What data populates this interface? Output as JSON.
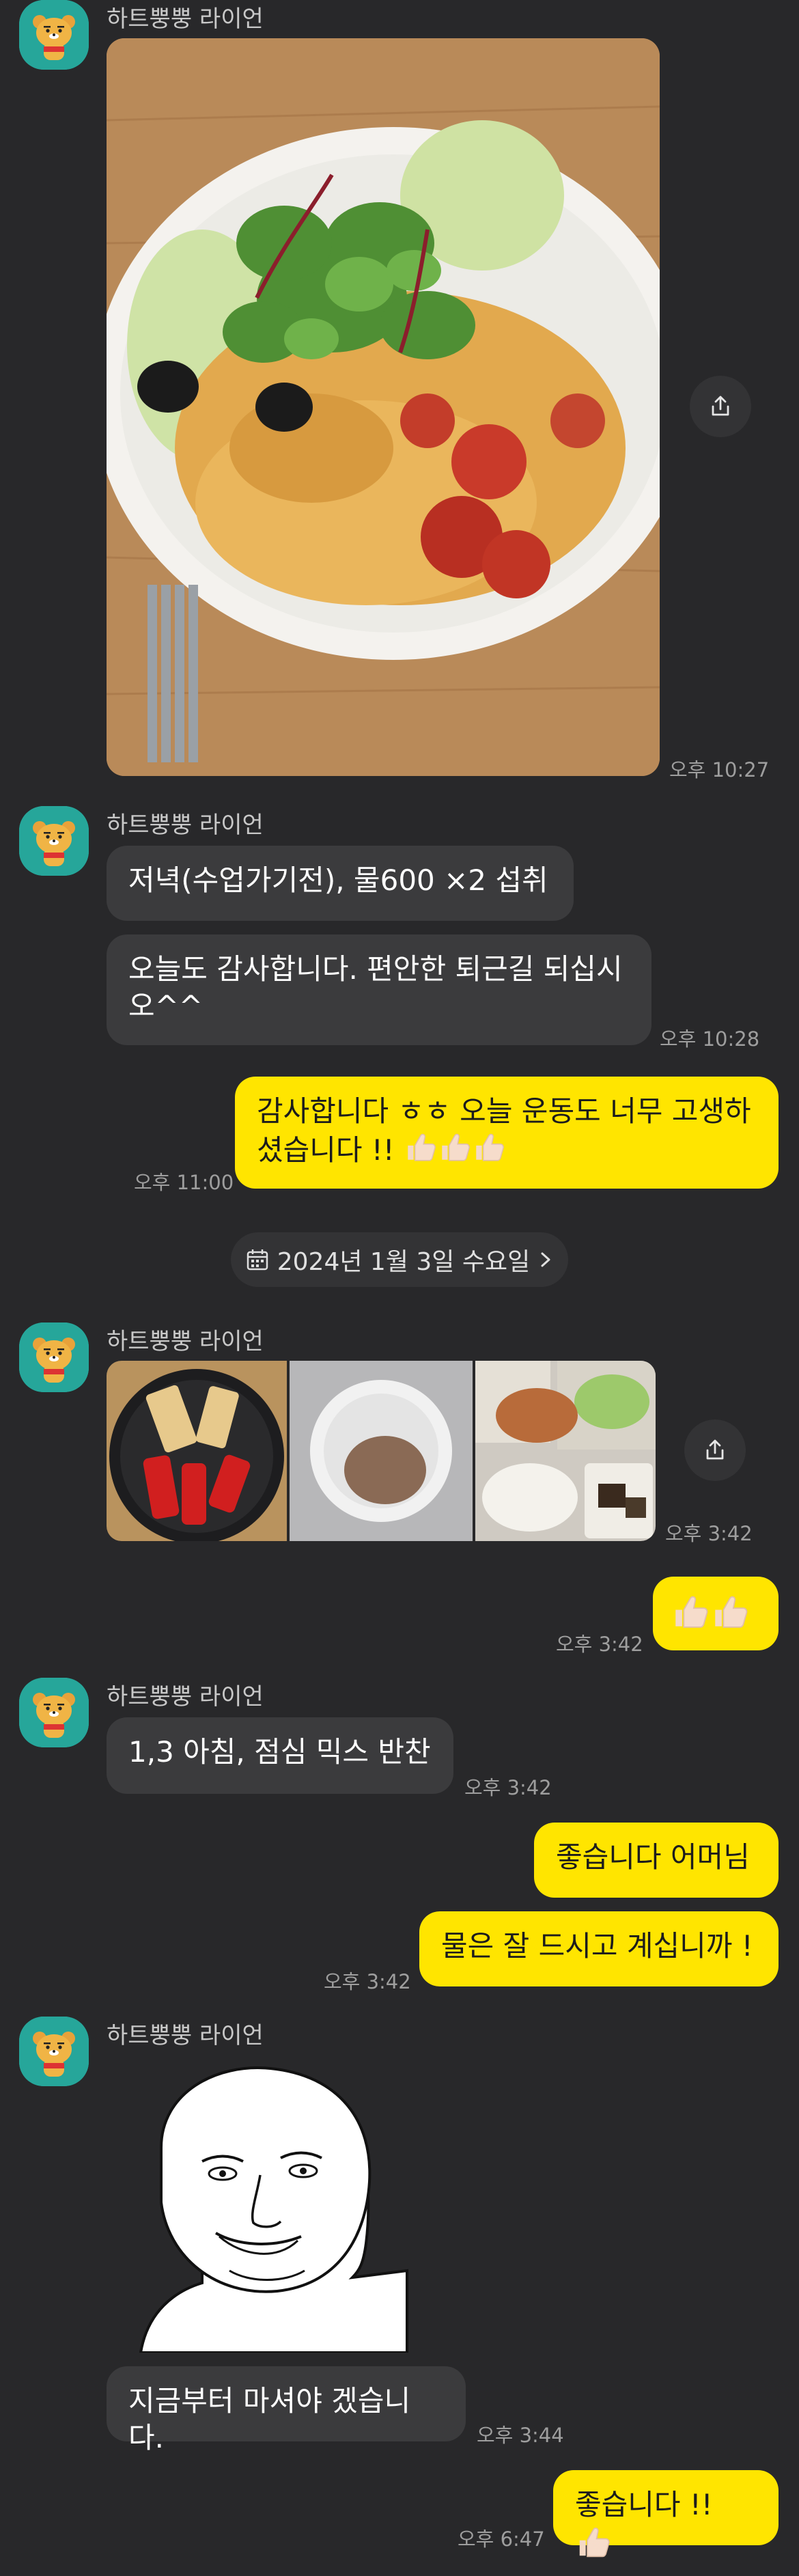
{
  "sender_name": "하트뿡뿡 라이언",
  "messages": {
    "photo_time": "오후 10:27",
    "m1_text": "저녁(수업가기전), 물600 ×2 섭취",
    "m2_text": "오늘도 감사합니다.  편안한 퇴근길 되십시오^^",
    "m2_time": "오후 10:28",
    "m3_text": "감사합니다 ㅎㅎ  오늘 운동도 너무 고생하셨습니다 !!",
    "m3_time": "오후 11:00",
    "date_divider": "2024년 1월 3일 수요일",
    "photos_time": "오후 3:42",
    "m4_time": "오후 3:42",
    "m5_text": "1,3 아침, 점심  믹스 반찬",
    "m5_time": "오후 3:42",
    "m6_text": "좋습니다 어머님",
    "m7_text": "물은 잘 드시고 계십니까 !",
    "m7_time": "오후 3:42",
    "m8_text": "지금부터 마셔야 겠습니다.",
    "m8_time": "오후 3:44",
    "m9_text": "좋습니다 !!",
    "m9_time": "오후 6:47"
  },
  "icons": {
    "avatar": "ryan-character-avatar",
    "share": "share-icon",
    "calendar": "calendar-icon",
    "chevron": "chevron-right-icon",
    "thumbs": "thumbs-up-emoji"
  },
  "colors": {
    "background": "#28282a",
    "incoming_bubble": "#3b3b3d",
    "outgoing_bubble": "#ffe500",
    "avatar_bg": "#26a69a"
  }
}
